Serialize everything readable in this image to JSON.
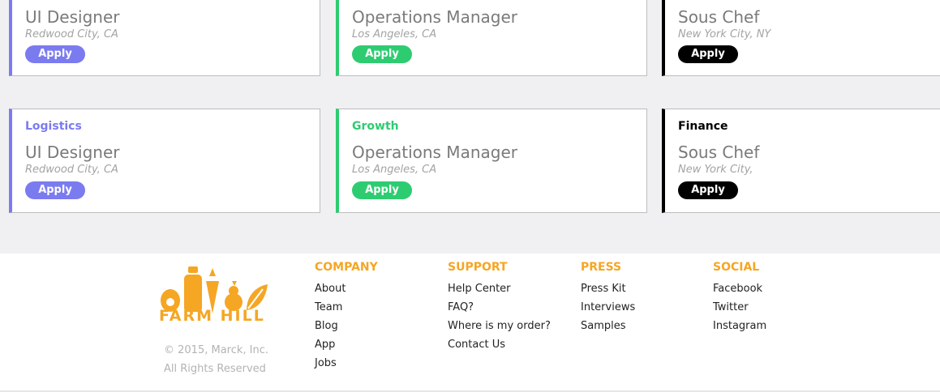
{
  "jobs": {
    "row1": [
      {
        "title": "UI Designer",
        "location": "Redwood City, CA",
        "apply": "Apply"
      },
      {
        "title": "Operations Manager",
        "location": "Los Angeles, CA",
        "apply": "Apply"
      },
      {
        "title": "Sous Chef",
        "location": "New York City, NY",
        "apply": "Apply"
      }
    ],
    "row2": [
      {
        "department": "Logistics",
        "title": "UI Designer",
        "location": "Redwood City, CA",
        "apply": "Apply"
      },
      {
        "department": "Growth",
        "title": "Operations Manager",
        "location": "Los Angeles, CA",
        "apply": "Apply"
      },
      {
        "department": "Finance",
        "title": "Sous Chef",
        "location": "New York City,",
        "apply": "Apply"
      }
    ]
  },
  "colors": {
    "logistics": "#7b7bf0",
    "growth": "#2ecc71",
    "finance": "#000000",
    "brand": "#f5a623"
  },
  "footer": {
    "logo_text": "FARM HILL",
    "copyright": "© 2015, Marck, Inc.",
    "rights": "All Rights Reserved",
    "columns": [
      {
        "heading": "COMPANY",
        "links": [
          "About",
          "Team",
          "Blog",
          "App",
          "Jobs"
        ]
      },
      {
        "heading": "SUPPORT",
        "links": [
          "Help Center",
          "FAQ?",
          "Where is my order?",
          "Contact Us"
        ]
      },
      {
        "heading": "PRESS",
        "links": [
          "Press Kit",
          "Interviews",
          "Samples"
        ]
      },
      {
        "heading": "SOCIAL",
        "links": [
          "Facebook",
          "Twitter",
          "Instagram"
        ]
      }
    ]
  }
}
